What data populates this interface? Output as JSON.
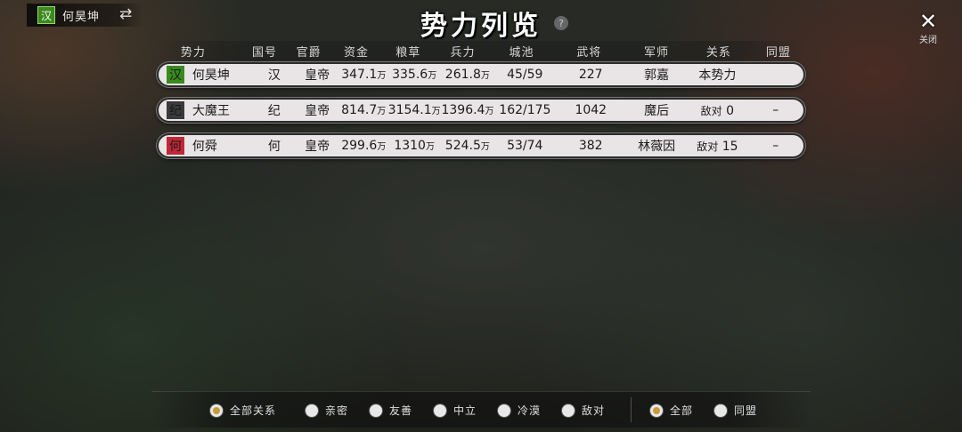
{
  "player": {
    "seal": "汉",
    "name": "何昊坤",
    "seal_color": "#3a8a1e"
  },
  "title": "势力列览",
  "help": "?",
  "close": {
    "label": "关闭"
  },
  "table": {
    "headers": [
      "势力",
      "国号",
      "官爵",
      "资金",
      "粮草",
      "兵力",
      "城池",
      "武将",
      "军师",
      "关系",
      "同盟"
    ],
    "rows": [
      {
        "seal": "汉",
        "seal_color": "#3a8a1e",
        "name": "何昊坤",
        "country": "汉",
        "rank": "皇帝",
        "funds": "347.1",
        "grain": "335.6",
        "troops": "261.8",
        "cities": "45/59",
        "generals": "227",
        "strategist": "郭嘉",
        "relation": "本势力",
        "alliance": ""
      },
      {
        "seal": "纪",
        "seal_color": "#3a3a3a",
        "name": "大魔王",
        "country": "纪",
        "rank": "皇帝",
        "funds": "814.7",
        "grain": "3154.1",
        "troops": "1396.4",
        "cities": "162/175",
        "generals": "1042",
        "strategist": "魔后",
        "relation": "敌对",
        "relation_value": "0",
        "alliance": "–"
      },
      {
        "seal": "何",
        "seal_color": "#c0283a",
        "name": "何舜",
        "country": "何",
        "rank": "皇帝",
        "funds": "299.6",
        "grain": "1310",
        "troops": "524.5",
        "cities": "53/74",
        "generals": "382",
        "strategist": "林薇因",
        "relation": "敌对",
        "relation_value": "15",
        "alliance": "–"
      }
    ],
    "unit": "万"
  },
  "filters": {
    "relations": [
      {
        "label": "全部关系",
        "selected": true
      },
      {
        "label": "亲密",
        "selected": false
      },
      {
        "label": "友善",
        "selected": false
      },
      {
        "label": "中立",
        "selected": false
      },
      {
        "label": "冷漠",
        "selected": false
      },
      {
        "label": "敌对",
        "selected": false
      }
    ],
    "alliance": [
      {
        "label": "全部",
        "selected": true
      },
      {
        "label": "同盟",
        "selected": false
      }
    ]
  }
}
